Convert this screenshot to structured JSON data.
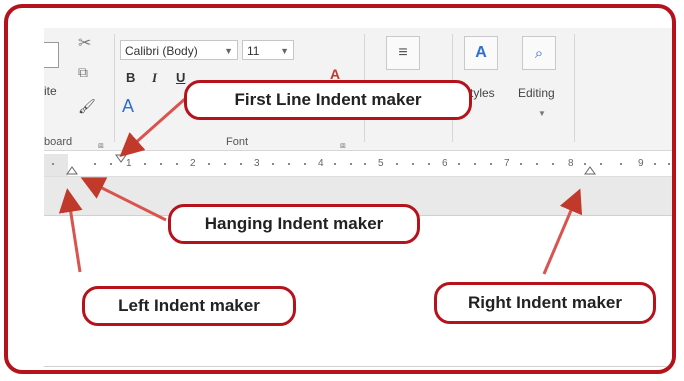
{
  "ribbon": {
    "clipboard_partial": "ite",
    "clipboard_label": "board",
    "font_name": "Calibri (Body)",
    "font_size": "11",
    "font_group_label": "Font",
    "styles_partial": "tyles",
    "editing_label": "Editing"
  },
  "ruler": {
    "numbers": [
      "1",
      "2",
      "3",
      "4",
      "5",
      "6",
      "7",
      "8",
      "9"
    ]
  },
  "callouts": {
    "first_line": "First Line Indent maker",
    "hanging": "Hanging Indent maker",
    "left": "Left Indent maker",
    "right": "Right Indent maker"
  },
  "colors": {
    "accent": "#b5121b"
  },
  "icons": [
    "scissors-icon",
    "copy-icon",
    "format-painter-icon",
    "bold-icon",
    "italic-icon",
    "underline-icon",
    "font-color-icon",
    "paragraph-icon",
    "styles-icon",
    "search-icon",
    "dialog-launcher-icon"
  ]
}
